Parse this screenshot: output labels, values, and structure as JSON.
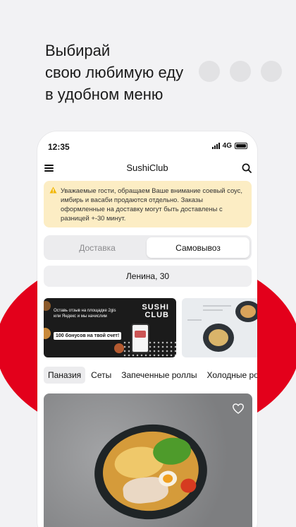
{
  "promo": {
    "headline_lines": [
      "Выбирай",
      "свою любимую еду",
      "в удобном меню"
    ]
  },
  "status_bar": {
    "time": "12:35",
    "network": "4G"
  },
  "app": {
    "title": "SushiClub"
  },
  "notice": {
    "text": "Уважаемые гости, обращаем Ваше внимание соевый соус, имбирь и васаби продаются отдельно. Заказы оформленные на доставку могут быть доставлены с разницей +-30 минут."
  },
  "order_mode": {
    "options": [
      "Доставка",
      "Самовывоз"
    ],
    "selected": "Самовывоз"
  },
  "address": {
    "value": "Ленина, 30"
  },
  "banners": {
    "first": {
      "text": "Оставь отзыв на площадке 2gis или Яндекс и мы начислим",
      "bonus": "100 бонусов на твой счет!",
      "logo_line1": "SUSHI",
      "logo_line2": "CLUB"
    }
  },
  "categories": {
    "items": [
      "Паназия",
      "Сеты",
      "Запеченные роллы",
      "Холодные роллы"
    ],
    "active": "Паназия"
  },
  "colors": {
    "accent_red": "#e3001b",
    "notice_bg": "#fcedc4",
    "warning_icon": "#f2b705"
  },
  "icons": {
    "menu": "hamburger-icon",
    "search": "search-icon",
    "warning": "warning-icon",
    "favorite": "heart-icon"
  }
}
